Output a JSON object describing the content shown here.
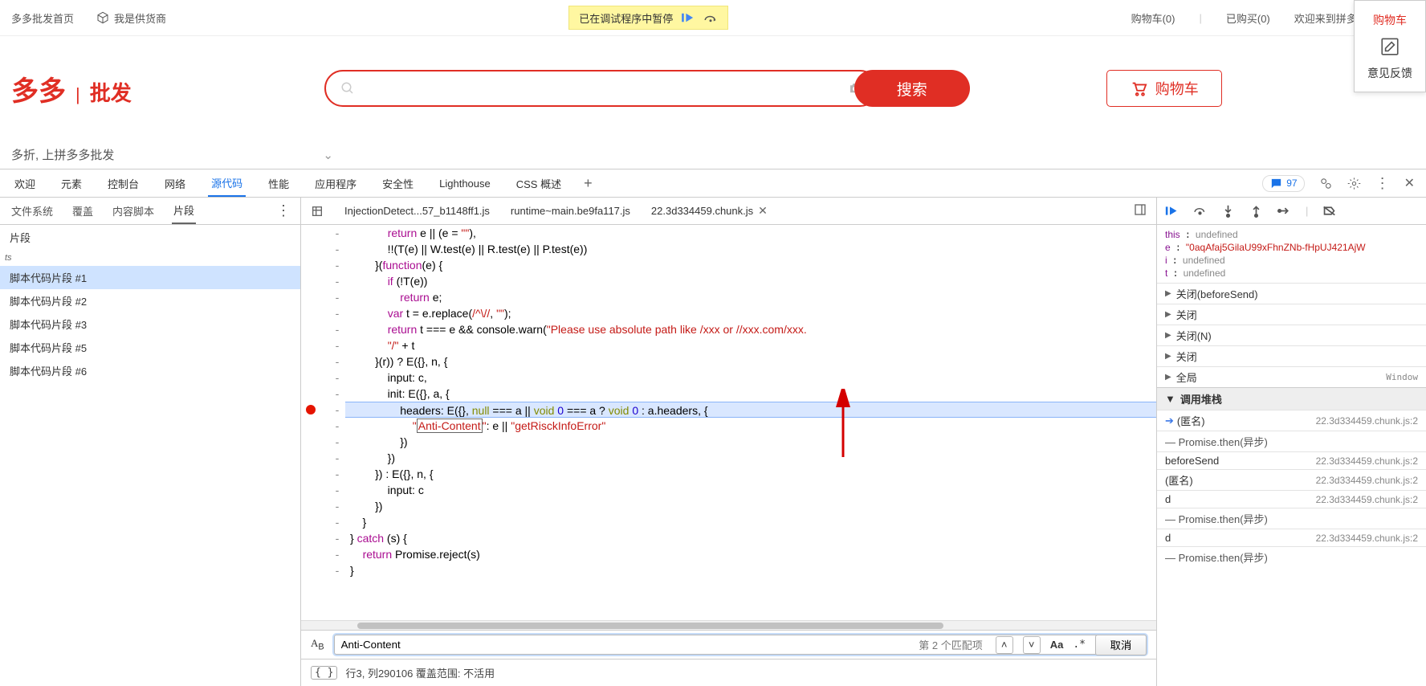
{
  "site": {
    "home": "多多批发首页",
    "supplier": "我是供货商",
    "pause": "已在调试程序中暂停",
    "cart": "购物车(0)",
    "bought": "已购买(0)",
    "welcome": "欢迎来到拼多多批发, 请先",
    "fb_cart": "购物车",
    "feedback": "意见反馈",
    "logo_main": "多多",
    "logo_sub": "批发",
    "search_btn": "搜索",
    "cart_btn": "购物车",
    "slogan": "多折, 上拼多多批发"
  },
  "devtabs": [
    "欢迎",
    "元素",
    "控制台",
    "网络",
    "源代码",
    "性能",
    "应用程序",
    "安全性",
    "Lighthouse",
    "CSS 概述"
  ],
  "devtabs_active": 4,
  "issues_count": "97",
  "left": {
    "subtabs": [
      "文件系统",
      "覆盖",
      "内容脚本",
      "片段"
    ],
    "subtabs_active": 3,
    "section1": "片段",
    "section2": "ts",
    "snippets": [
      "脚本代码片段 #1",
      "脚本代码片段 #2",
      "脚本代码片段 #3",
      "脚本代码片段 #5",
      "脚本代码片段 #6"
    ],
    "snippets_sel": 0
  },
  "mid": {
    "files": [
      "InjectionDetect...57_b1148ff1.js",
      "runtime~main.be9fa117.js",
      "22.3d334459.chunk.js"
    ],
    "files_active": 2,
    "search_value": "Anti-Content",
    "matches": "第 2 个匹配项",
    "cancel": "取消",
    "status": "行3, 列290106   覆盖范围: 不活用"
  },
  "scope": {
    "this": "undefined",
    "e": "\"0aqAfaj5GilaU99xFhnZNb-fHpUJ421AjW",
    "i": "undefined",
    "t": "undefined"
  },
  "closures": [
    "关闭(beforeSend)",
    "关闭",
    "关闭(N)",
    "关闭",
    "全局"
  ],
  "global_rgt": "Window",
  "callstack_label": "调用堆栈",
  "callstack": [
    {
      "name": "(匿名)",
      "loc": "22.3d334459.chunk.js:2",
      "cur": true
    },
    {
      "group": "Promise.then(异步)"
    },
    {
      "name": "beforeSend",
      "loc": "22.3d334459.chunk.js:2"
    },
    {
      "name": "(匿名)",
      "loc": "22.3d334459.chunk.js:2"
    },
    {
      "name": "d",
      "loc": "22.3d334459.chunk.js:2"
    },
    {
      "group": "Promise.then(异步)"
    },
    {
      "name": "d",
      "loc": "22.3d334459.chunk.js:2"
    },
    {
      "group": "Promise.then(异步)"
    }
  ]
}
